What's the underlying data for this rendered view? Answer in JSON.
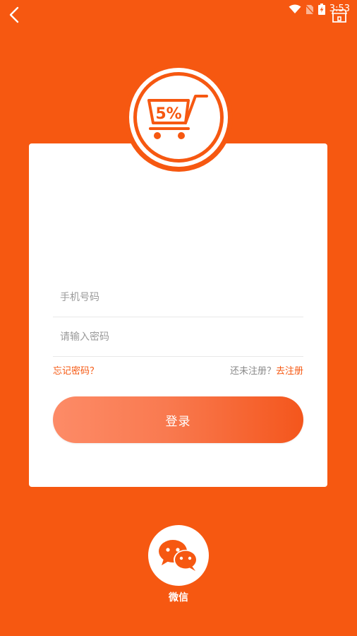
{
  "status_bar": {
    "time": "3:53",
    "icons": [
      "wifi-icon",
      "no-sim-icon",
      "battery-charging-icon"
    ]
  },
  "header": {
    "back_icon": "chevron-left-icon",
    "store_icon": "store-icon"
  },
  "logo": {
    "text": "5%",
    "icon": "shopping-cart-icon"
  },
  "form": {
    "phone_placeholder": "手机号码",
    "password_placeholder": "请输入密码",
    "forgot_label": "忘记密码？",
    "register_prompt": "还未注册？",
    "register_label": "去注册",
    "login_label": "登录"
  },
  "social": {
    "wechat_label": "微信",
    "wechat_icon": "wechat-icon"
  },
  "colors": {
    "background": "#f65811",
    "accent": "#f65811",
    "card": "#ffffff",
    "button_gradient_start": "#fd8b67",
    "button_gradient_end": "#f4561c"
  }
}
